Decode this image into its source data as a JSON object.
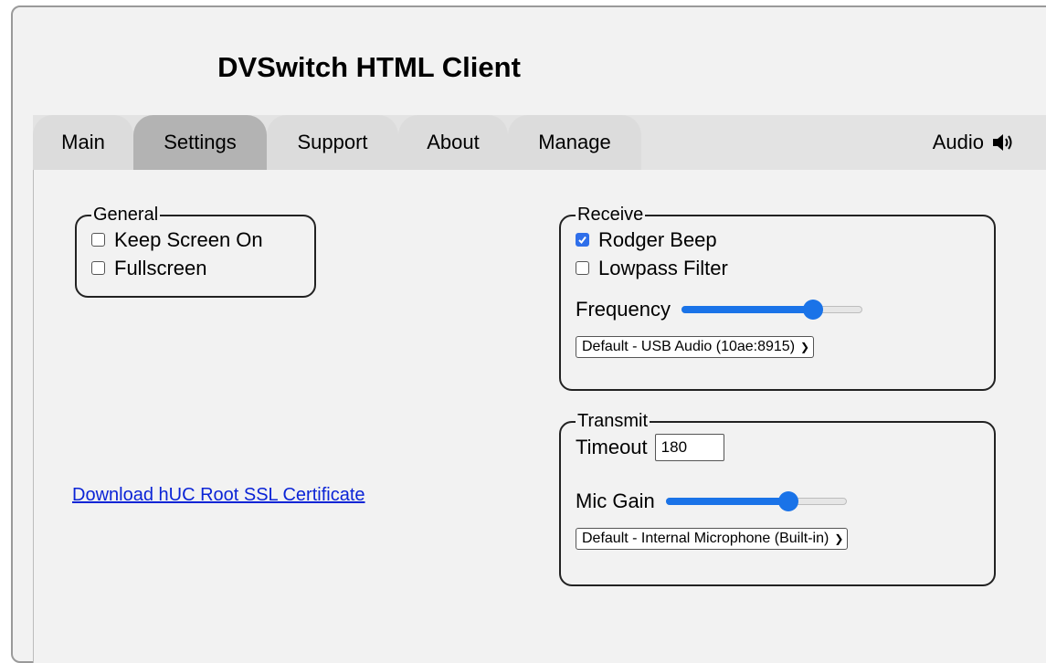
{
  "app": {
    "title": "DVSwitch HTML Client"
  },
  "tabs": [
    {
      "label": "Main",
      "active": false
    },
    {
      "label": "Settings",
      "active": true
    },
    {
      "label": "Support",
      "active": false
    },
    {
      "label": "About",
      "active": false
    },
    {
      "label": "Manage",
      "active": false
    }
  ],
  "audio": {
    "label": "Audio",
    "icon": "speaker-icon"
  },
  "general": {
    "legend": "General",
    "keep_screen_on": {
      "label": "Keep Screen On",
      "checked": false
    },
    "fullscreen": {
      "label": "Fullscreen",
      "checked": false
    }
  },
  "download_link": "Download hUC Root SSL Certificate",
  "receive": {
    "legend": "Receive",
    "rodger_beep": {
      "label": "Rodger Beep",
      "checked": true
    },
    "lowpass_filter": {
      "label": "Lowpass Filter",
      "checked": false
    },
    "frequency": {
      "label": "Frequency",
      "level": 0.73
    },
    "device": {
      "selected": "Default - USB Audio (10ae:8915)"
    }
  },
  "transmit": {
    "legend": "Transmit",
    "timeout": {
      "label": "Timeout",
      "value": "180"
    },
    "mic_gain": {
      "label": "Mic Gain",
      "level": 0.68
    },
    "device": {
      "selected": "Default - Internal Microphone (Built-in)"
    }
  },
  "colors": {
    "accent": "#1a73e8",
    "active_tab": "#b3b3b3",
    "tab_bar": "#e3e3e3",
    "panel": "#f2f2f2"
  }
}
